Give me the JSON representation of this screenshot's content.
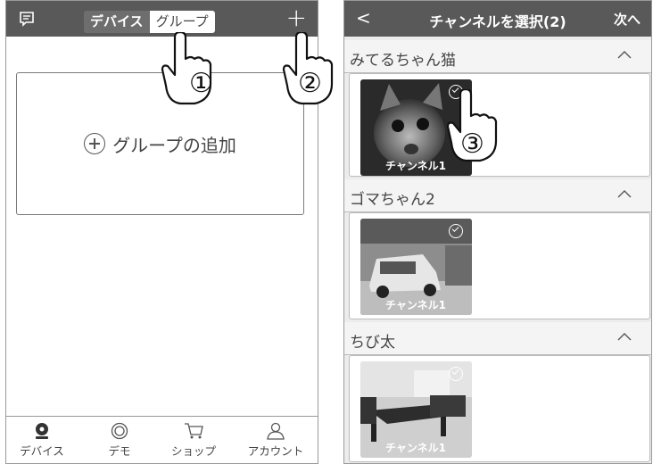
{
  "left_screen": {
    "header": {
      "segment": [
        "デバイス",
        "グループ"
      ],
      "plus_label": "+"
    },
    "add_group_label": "グループの追加",
    "tabs": [
      "デバイス",
      "デモ",
      "ショップ",
      "アカウント"
    ]
  },
  "right_screen": {
    "header": {
      "back": "<",
      "title": "チャンネルを選択(2)",
      "next": "次へ"
    },
    "groups": [
      {
        "name": "みてるちゃん猫",
        "channel": "チャンネル1"
      },
      {
        "name": "ゴマちゃん2",
        "channel": "チャンネル1"
      },
      {
        "name": "ちび太",
        "channel": "チャンネル1"
      }
    ]
  },
  "annotations": [
    "①",
    "②",
    "③"
  ]
}
